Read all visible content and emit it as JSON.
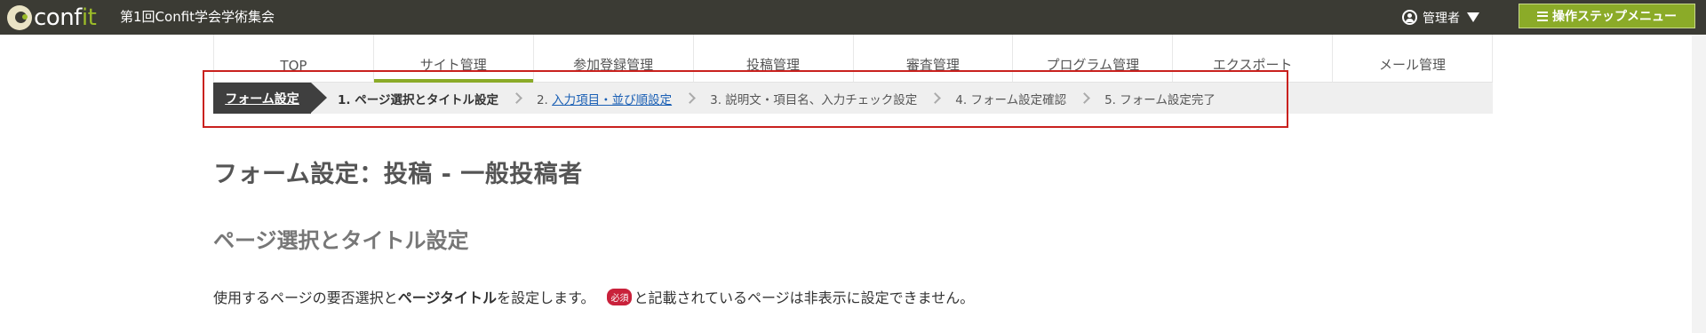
{
  "header": {
    "logo_text_main": "conf",
    "logo_text_accent": "it",
    "event_title": "第1回Confit学会学術集会",
    "admin_label": "管理者",
    "step_menu_label": "操作ステップメニュー",
    "colors": {
      "topbar": "#3b3b34",
      "accent": "#8bab28"
    }
  },
  "nav": {
    "tabs": [
      {
        "label": "TOP"
      },
      {
        "label": "サイト管理"
      },
      {
        "label": "参加登録管理"
      },
      {
        "label": "投稿管理"
      },
      {
        "label": "審査管理"
      },
      {
        "label": "プログラム管理"
      },
      {
        "label": "エクスポート"
      },
      {
        "label": "メール管理"
      }
    ],
    "active_index": 1
  },
  "stepbar": {
    "section_label": "フォーム設定",
    "steps": [
      {
        "label": "1. ページ選択とタイトル設定",
        "state": "current"
      },
      {
        "num": "2. ",
        "link": "入力項目・並び順設定",
        "state": "link"
      },
      {
        "label": "3. 説明文・項目名、入力チェック設定",
        "state": "pending"
      },
      {
        "label": "4. フォーム設定確認",
        "state": "pending"
      },
      {
        "label": "5. フォーム設定完了",
        "state": "pending"
      }
    ],
    "highlight_color": "#c9211e"
  },
  "main": {
    "page_title": "フォーム設定：投稿 - 一般投稿者",
    "sub_title": "ページ選択とタイトル設定",
    "desc_prefix": "使用するページの要否選択と",
    "desc_bold": "ページタイトル",
    "desc_middle": "を設定します。",
    "required_badge": "必須",
    "desc_suffix": "と記載されているページは非表示に設定できません。"
  }
}
